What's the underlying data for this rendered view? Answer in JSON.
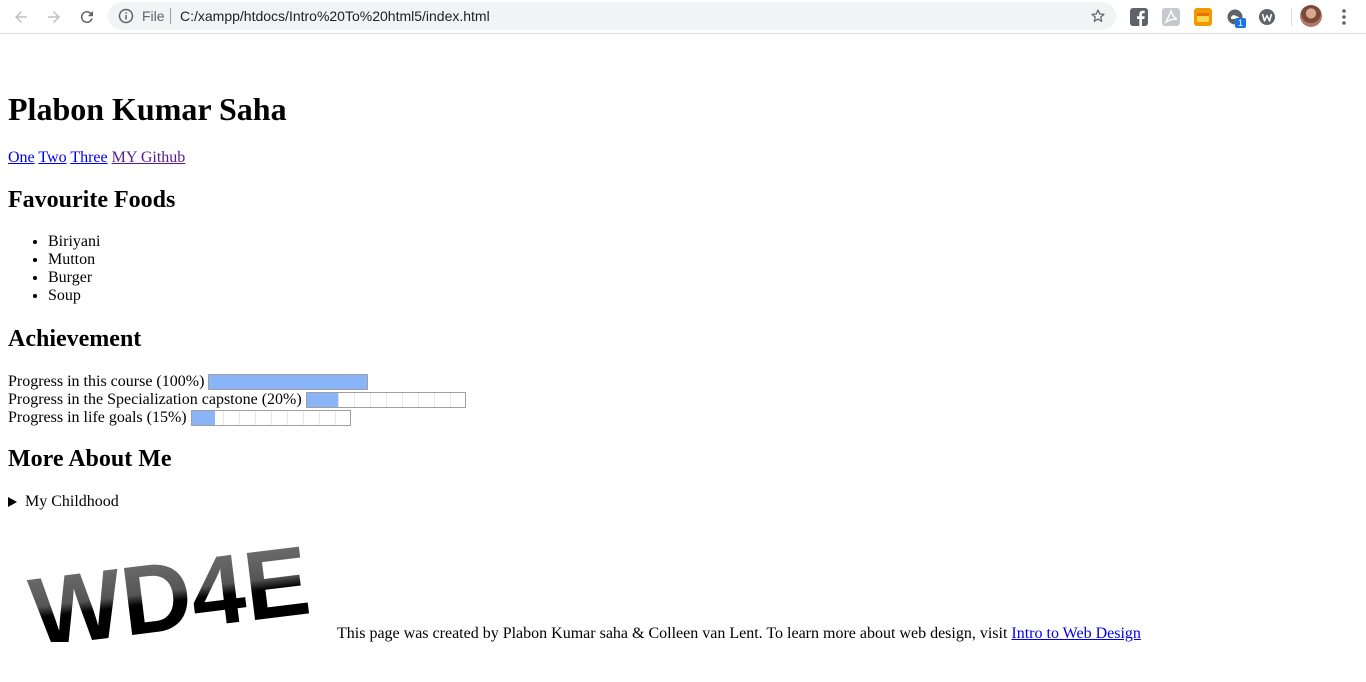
{
  "browser": {
    "scheme_label": "File",
    "url": "C:/xampp/htdocs/Intro%20To%20html5/index.html",
    "extension_badge": "1"
  },
  "page": {
    "title": "Plabon Kumar Saha",
    "links": [
      {
        "label": "One"
      },
      {
        "label": "Two"
      },
      {
        "label": "Three"
      },
      {
        "label": "MY Github"
      }
    ],
    "foods_heading": "Favourite Foods",
    "foods": [
      "Biriyani",
      "Mutton",
      "Burger",
      "Soup"
    ],
    "achievement_heading": "Achievement",
    "progress": [
      {
        "label": "Progress in this course (100%)",
        "value": 1.0
      },
      {
        "label": "Progress in the Specialization capstone (20%)",
        "value": 0.2
      },
      {
        "label": "Progress in life goals (15%)",
        "value": 0.15
      }
    ],
    "more_heading": "More About Me",
    "details_summary": "My Childhood",
    "logo_text": "WD4E",
    "footer_text": "This page was created by Plabon Kumar saha & Colleen van Lent. To learn more about web design, visit ",
    "footer_link": "Intro to Web Design"
  },
  "colors": {
    "link": "#0000ee",
    "visited_link": "#551a8b",
    "progress_fill": "#8ab4f8"
  }
}
